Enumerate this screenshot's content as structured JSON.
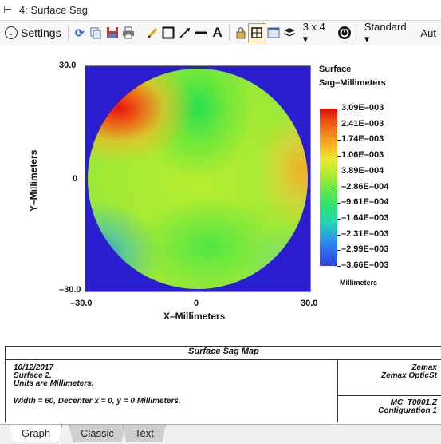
{
  "window": {
    "title": "4: Surface Sag",
    "pin_glyph": "⊢"
  },
  "toolbar": {
    "settings_label": "Settings",
    "layout_label": "3 x 4 ▾",
    "standard_label": "Standard ▾",
    "auto_label": "Aut"
  },
  "plot": {
    "legend_title_line1": "Surface",
    "legend_title_line2": "Sag–Millimeters",
    "xlabel": "X–Millimeters",
    "ylabel": "Y–Millimeters",
    "x_ticks": [
      "–30.0",
      "0",
      "30.0"
    ],
    "y_ticks": [
      "30.0",
      "0",
      "–30.0"
    ],
    "colorbar_labels": [
      "3.09E–003",
      "2.41E–003",
      "1.74E–003",
      "1.06E–003",
      "3.89E–004",
      "–2.86E–004",
      "–9.61E–004",
      "–1.64E–003",
      "–2.31E–003",
      "–2.99E–003",
      "–3.66E–003"
    ],
    "colorbar_units": "Millimeters"
  },
  "chart_data": {
    "type": "heatmap",
    "title": "Surface Sag Map",
    "xlabel": "X–Millimeters",
    "ylabel": "Y–Millimeters",
    "xlim": [
      -30.0,
      30.0
    ],
    "ylim": [
      -30.0,
      30.0
    ],
    "colorbar_title": "Surface Sag–Millimeters",
    "colorbar_range": [
      -0.00366,
      0.00309
    ],
    "colorbar_ticks": [
      0.00309,
      0.00241,
      0.00174,
      0.00106,
      0.000389,
      -0.000286,
      -0.000961,
      -0.00164,
      -0.00231,
      -0.00299,
      -0.00366
    ],
    "units": "Millimeters"
  },
  "info": {
    "caption": "Surface Sag Map",
    "date": "10/12/2017",
    "surface": "Surface 2.",
    "units_line": "Units are Millimeters.",
    "width_line": "Width = 60, Decenter x = 0, y = 0 Millimeters.",
    "company": "Zemax",
    "product": "Zemax OpticSt",
    "file": "MC_T0001.Z",
    "config": "Configuration 1"
  },
  "tabs": [
    {
      "label": "Graph",
      "active": true
    },
    {
      "label": "Classic",
      "active": false
    },
    {
      "label": "Text",
      "active": false
    }
  ],
  "colors": {
    "background_field": "#2b1ed0",
    "accent": "#d49a2a"
  }
}
